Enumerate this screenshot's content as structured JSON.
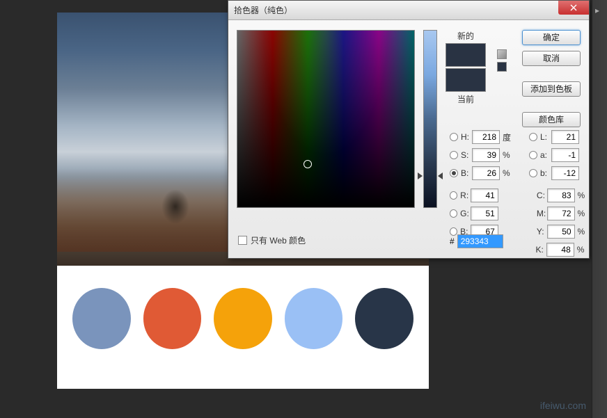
{
  "dialog": {
    "title": "拾色器（纯色）",
    "new_label": "新的",
    "current_label": "当前",
    "buttons": {
      "ok": "确定",
      "cancel": "取消",
      "add_swatch": "添加到色板",
      "color_lib": "颜色库"
    },
    "web_only_label": "只有 Web 颜色",
    "hex_prefix": "#",
    "hex_value": "293343",
    "hsb": {
      "h": "218",
      "h_unit": "度",
      "s": "39",
      "s_unit": "%",
      "b": "26",
      "b_unit": "%"
    },
    "lab": {
      "l": "21",
      "a": "-1",
      "b": "-12"
    },
    "rgb": {
      "r": "41",
      "g": "51",
      "b": "67"
    },
    "cmyk": {
      "c": "83",
      "m": "72",
      "y": "50",
      "k": "48"
    },
    "labels": {
      "H": "H:",
      "S": "S:",
      "B": "B:",
      "R": "R:",
      "G": "G:",
      "Bb": "B:",
      "L": "L:",
      "a": "a:",
      "b": "b:",
      "C": "C:",
      "M": "M:",
      "Y": "Y:",
      "K": "K:"
    }
  },
  "swatches": [
    "#7a94bc",
    "#e05a35",
    "#f5a20a",
    "#9ac0f5",
    "#283548"
  ],
  "watermark": "ifeiwu.com"
}
